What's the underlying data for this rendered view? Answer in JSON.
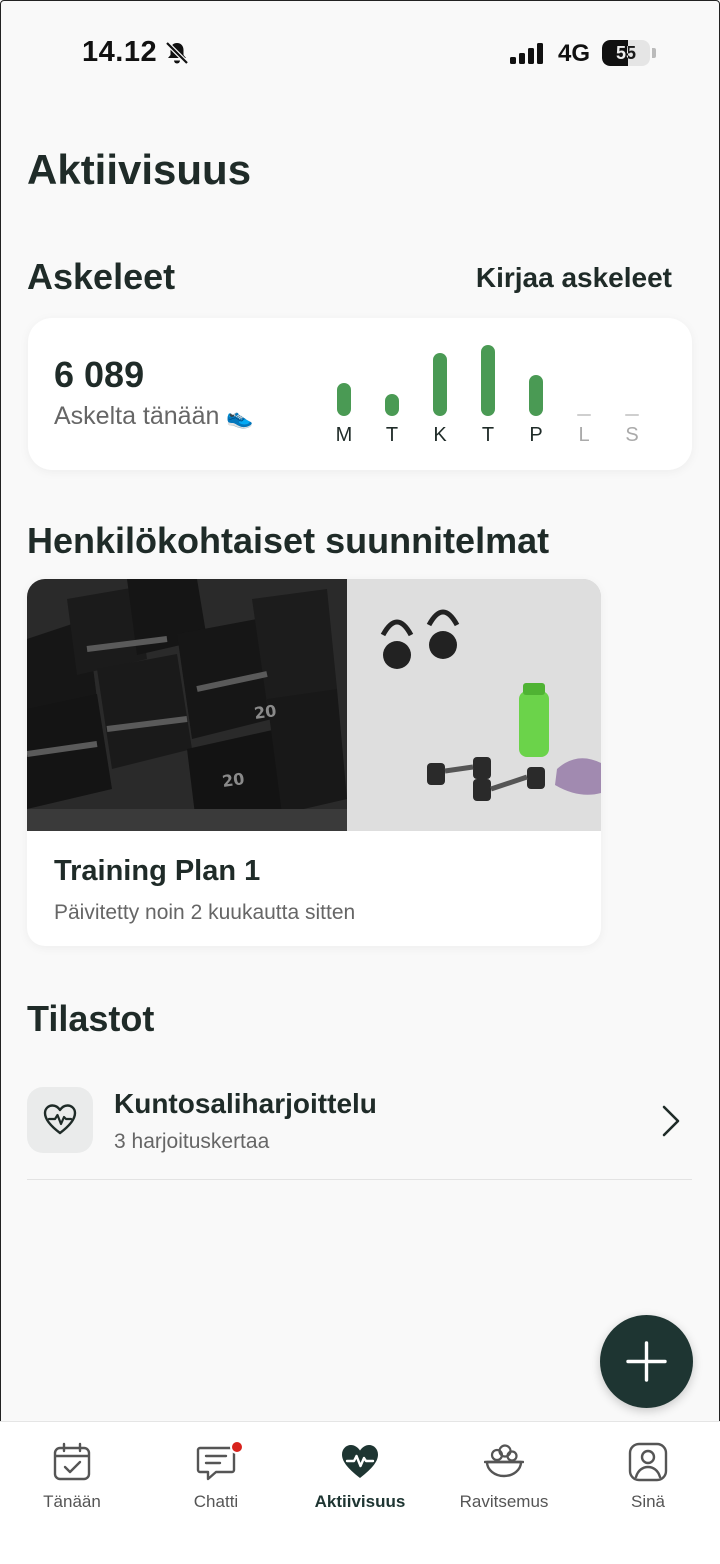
{
  "status_bar": {
    "time": "14.12",
    "network": "4G",
    "battery_level": "55",
    "battery_fraction": 0.55
  },
  "page": {
    "title": "Aktiivisuus"
  },
  "steps": {
    "section_title": "Askeleet",
    "log_link": "Kirjaa askeleet",
    "count": "6 089",
    "caption": "Askelta tänään",
    "caption_icon": "shoe-icon",
    "days": [
      {
        "label": "M",
        "value": 0.45,
        "future": false
      },
      {
        "label": "T",
        "value": 0.3,
        "future": false
      },
      {
        "label": "K",
        "value": 0.85,
        "future": false
      },
      {
        "label": "T",
        "value": 0.96,
        "future": false
      },
      {
        "label": "P",
        "value": 0.55,
        "future": false
      },
      {
        "label": "L",
        "value": 0,
        "future": true
      },
      {
        "label": "S",
        "value": 0,
        "future": true
      }
    ],
    "bar_color": "#4a9a54"
  },
  "plans": {
    "section_title": "Henkilökohtaiset suunnitelmat",
    "items": [
      {
        "title": "Training Plan 1",
        "subtitle": "Päivitetty noin 2 kuukautta sitten",
        "image": "gym-dumbbells-photo"
      }
    ]
  },
  "stats": {
    "section_title": "Tilastot",
    "items": [
      {
        "icon": "heart-pulse-icon",
        "title": "Kuntosaliharjoittelu",
        "subtitle": "3 harjoituskertaa"
      }
    ]
  },
  "fab": {
    "icon": "plus-icon",
    "color": "#1e3532"
  },
  "tab_bar": {
    "tabs": [
      {
        "label": "Tänään",
        "icon": "calendar-check-icon",
        "active": false
      },
      {
        "label": "Chatti",
        "icon": "chat-icon",
        "active": false,
        "badge": true
      },
      {
        "label": "Aktiivisuus",
        "icon": "heart-activity-icon",
        "active": true
      },
      {
        "label": "Ravitsemus",
        "icon": "food-bowl-icon",
        "active": false
      },
      {
        "label": "Sinä",
        "icon": "profile-icon",
        "active": false
      }
    ]
  }
}
